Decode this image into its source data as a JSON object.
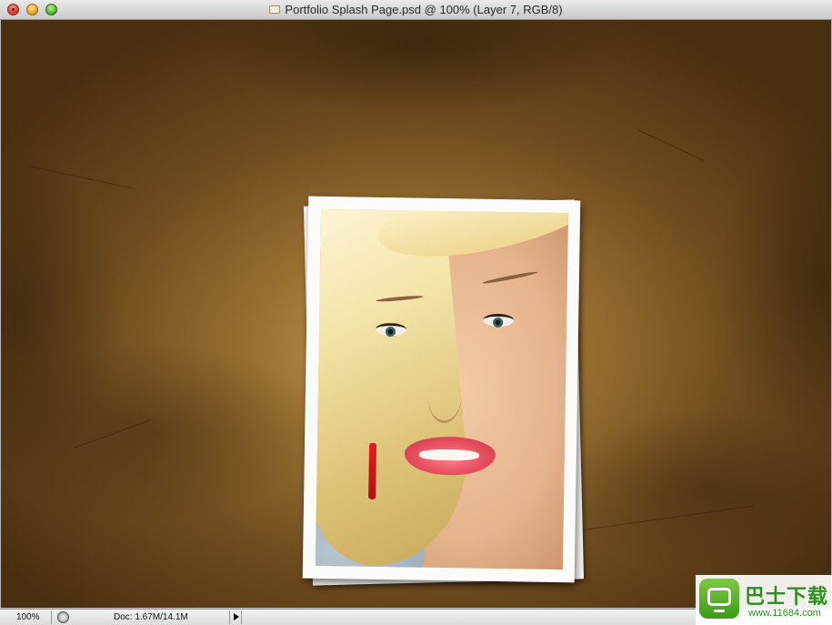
{
  "window": {
    "title": "Portfolio Splash Page.psd @ 100% (Layer 7, RGB/8)"
  },
  "canvas": {
    "background": "textured brown paper",
    "photo": {
      "subject": "portrait of a blonde woman"
    }
  },
  "status_bar": {
    "zoom": "100%",
    "doc_info": "Doc: 1.67M/14.1M"
  },
  "watermark": {
    "text": "巴士下载",
    "url": "www.11684.com"
  },
  "colors": {
    "accent_close": "#e0443b",
    "accent_minimize": "#e9a82a",
    "accent_maximize": "#5cb93a",
    "watermark_green": "#2e8f1e"
  }
}
